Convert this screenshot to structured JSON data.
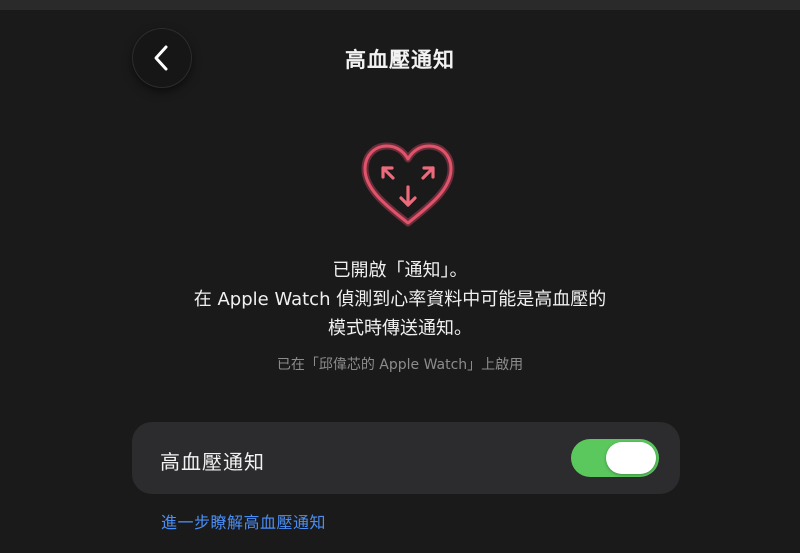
{
  "header": {
    "back_icon": "chevron-left-icon",
    "title": "高血壓通知"
  },
  "hero": {
    "icon": "heart-arrows-icon",
    "icon_color": "#e0536a",
    "icon_glow": "#6b2d3a"
  },
  "description": {
    "line1": "已開啟「通知」。",
    "line2": "在 Apple Watch 偵測到心率資料中可能是高血壓的",
    "line3": "模式時傳送通知。"
  },
  "enabled_on": "已在「邱偉芯的 Apple Watch」上啟用",
  "setting": {
    "label": "高血壓通知",
    "toggle_on": true,
    "toggle_color": "#5bc85e"
  },
  "learn_more": "進一步瞭解高血壓通知"
}
